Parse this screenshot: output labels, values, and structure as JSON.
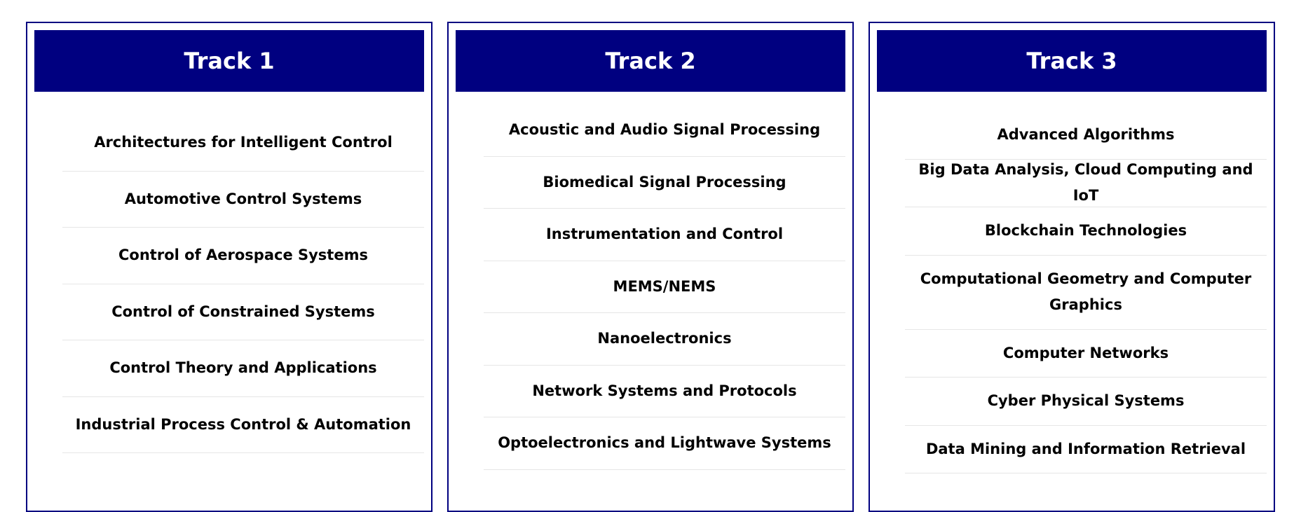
{
  "tracks": [
    {
      "title": "Track 1",
      "topics": [
        "Architectures for Intelligent Control",
        "Automotive Control Systems",
        "Control of Aerospace Systems",
        "Control of Constrained Systems",
        "Control Theory and Applications",
        "Industrial Process Control & Automation"
      ]
    },
    {
      "title": "Track 2",
      "topics": [
        "Acoustic and Audio Signal Processing",
        "Biomedical Signal Processing",
        "Instrumentation and Control",
        "MEMS/NEMS",
        "Nanoelectronics",
        "Network Systems and Protocols",
        "Optoelectronics and Lightwave Systems"
      ]
    },
    {
      "title": "Track 3",
      "topics": [
        "Advanced Algorithms",
        "Big Data Analysis, Cloud Computing and IoT",
        "Blockchain Technologies",
        "Computational Geometry and Computer Graphics",
        "Computer Networks",
        "Cyber Physical Systems",
        "Data Mining and Information Retrieval"
      ]
    }
  ],
  "colors": {
    "header_bg": "#000080",
    "border": "#000080",
    "header_text": "#ffffff"
  }
}
